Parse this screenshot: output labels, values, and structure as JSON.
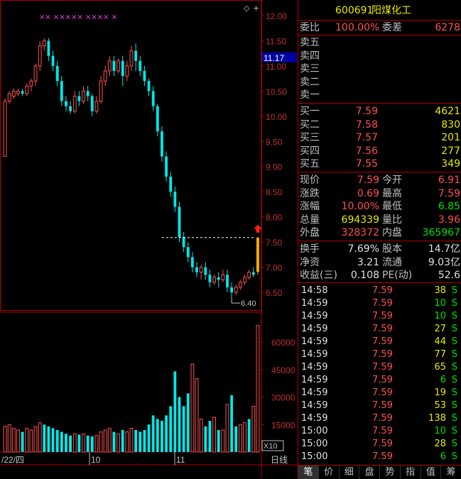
{
  "stock": {
    "code": "600691",
    "name": "阳煤化工"
  },
  "colors": {
    "up": "#ff5050",
    "down": "#00e8e8",
    "grid": "#b00000",
    "limit_bar": "#ffb000"
  },
  "order_ratio": {
    "label1": "委比",
    "value1": "100.00%",
    "label2": "委差",
    "value2": "6278"
  },
  "asks": [
    {
      "label": "卖五",
      "price": "",
      "vol": ""
    },
    {
      "label": "卖四",
      "price": "",
      "vol": ""
    },
    {
      "label": "卖三",
      "price": "",
      "vol": ""
    },
    {
      "label": "卖二",
      "price": "",
      "vol": ""
    },
    {
      "label": "卖一",
      "price": "",
      "vol": ""
    }
  ],
  "bids": [
    {
      "label": "买一",
      "price": "7.59",
      "vol": "4621"
    },
    {
      "label": "买二",
      "price": "7.58",
      "vol": "830"
    },
    {
      "label": "买三",
      "price": "7.57",
      "vol": "201"
    },
    {
      "label": "买四",
      "price": "7.56",
      "vol": "277"
    },
    {
      "label": "买五",
      "price": "7.55",
      "vol": "349"
    }
  ],
  "quote": [
    {
      "l1": "现价",
      "v1": "7.59",
      "c1": "red",
      "l2": "今开",
      "v2": "6.91",
      "c2": "red"
    },
    {
      "l1": "涨跌",
      "v1": "0.69",
      "c1": "red",
      "l2": "最高",
      "v2": "7.59",
      "c2": "red"
    },
    {
      "l1": "涨幅",
      "v1": "10.00%",
      "c1": "red",
      "l2": "最低",
      "v2": "6.85",
      "c2": "green"
    },
    {
      "l1": "总量",
      "v1": "694339",
      "c1": "yellow",
      "l2": "量比",
      "v2": "3.96",
      "c2": "red"
    },
    {
      "l1": "外盘",
      "v1": "328372",
      "c1": "red",
      "l2": "内盘",
      "v2": "365967",
      "c2": "green"
    }
  ],
  "stats": [
    {
      "l1": "换手",
      "v1": "7.69%",
      "l2": "股本",
      "v2": "14.7亿"
    },
    {
      "l1": "净资",
      "v1": "3.21",
      "l2": "流通",
      "v2": "9.03亿"
    },
    {
      "l1": "收益(三)",
      "v1": "0.108",
      "l2": "PE(动)",
      "v2": "52.6"
    }
  ],
  "ticks": [
    {
      "time": "14:58",
      "price": "7.59",
      "vol": "38",
      "side": "S",
      "vc": "yellow"
    },
    {
      "time": "14:59",
      "price": "7.59",
      "vol": "10",
      "side": "S",
      "vc": "green"
    },
    {
      "time": "14:59",
      "price": "7.59",
      "vol": "10",
      "side": "S",
      "vc": "green"
    },
    {
      "time": "14:59",
      "price": "7.59",
      "vol": "27",
      "side": "S",
      "vc": "yellow"
    },
    {
      "time": "14:59",
      "price": "7.59",
      "vol": "44",
      "side": "S",
      "vc": "yellow"
    },
    {
      "time": "14:59",
      "price": "7.59",
      "vol": "77",
      "side": "S",
      "vc": "yellow"
    },
    {
      "time": "14:59",
      "price": "7.59",
      "vol": "65",
      "side": "S",
      "vc": "yellow"
    },
    {
      "time": "14:59",
      "price": "7.59",
      "vol": "6",
      "side": "S",
      "vc": "green"
    },
    {
      "time": "14:59",
      "price": "7.59",
      "vol": "19",
      "side": "S",
      "vc": "yellow"
    },
    {
      "time": "14:59",
      "price": "7.59",
      "vol": "53",
      "side": "S",
      "vc": "yellow"
    },
    {
      "time": "14:59",
      "price": "7.59",
      "vol": "138",
      "side": "S",
      "vc": "yellow"
    },
    {
      "time": "15:00",
      "price": "7.59",
      "vol": "10",
      "side": "S",
      "vc": "green"
    },
    {
      "time": "15:00",
      "price": "7.59",
      "vol": "28",
      "side": "S",
      "vc": "yellow"
    },
    {
      "time": "15:00",
      "price": "7.59",
      "vol": "6",
      "side": "S",
      "vc": "green"
    }
  ],
  "tabs": [
    "笔",
    "价",
    "细",
    "盘",
    "势",
    "指",
    "值",
    "筹"
  ],
  "chart": {
    "price_axis": [
      "12.00",
      "11.50",
      "11.00",
      "10.50",
      "10.00",
      "9.50",
      "9.00",
      "8.50",
      "8.00",
      "7.50",
      "7.00",
      "6.50"
    ],
    "current_price_tag": "11.17",
    "low_label": "6.40",
    "volume_axis": [
      "60000",
      "45000",
      "30000",
      "15000"
    ],
    "volume_unit": "X10",
    "date_labels": [
      "/22/四",
      "10",
      "11"
    ],
    "period_label": "日线",
    "markers": "××  ×××××  ××××  ×",
    "candles": [
      [
        9.2,
        10.3,
        9.2,
        10.35,
        1
      ],
      [
        10.3,
        10.45,
        10.25,
        10.5,
        1
      ],
      [
        10.4,
        10.5,
        10.35,
        10.55,
        1
      ],
      [
        10.45,
        10.5,
        10.4,
        10.55,
        1
      ],
      [
        10.5,
        10.45,
        10.4,
        10.55,
        0
      ],
      [
        10.45,
        10.6,
        10.4,
        10.65,
        1
      ],
      [
        10.6,
        10.7,
        10.5,
        10.75,
        1
      ],
      [
        10.7,
        11.0,
        10.6,
        11.05,
        1
      ],
      [
        11.0,
        11.4,
        10.9,
        11.5,
        1
      ],
      [
        11.4,
        11.5,
        11.3,
        11.55,
        1
      ],
      [
        11.5,
        11.2,
        11.1,
        11.55,
        0
      ],
      [
        11.2,
        11.0,
        10.9,
        11.3,
        0
      ],
      [
        11.0,
        10.7,
        10.6,
        11.1,
        0
      ],
      [
        10.7,
        10.3,
        10.2,
        10.8,
        0
      ],
      [
        10.3,
        10.2,
        10.1,
        10.4,
        0
      ],
      [
        10.2,
        10.1,
        10.05,
        10.3,
        0
      ],
      [
        10.1,
        10.4,
        10.05,
        10.5,
        1
      ],
      [
        10.4,
        10.3,
        10.2,
        10.5,
        0
      ],
      [
        10.3,
        10.5,
        10.25,
        10.6,
        1
      ],
      [
        10.5,
        10.4,
        10.3,
        10.6,
        0
      ],
      [
        10.4,
        10.1,
        10.0,
        10.45,
        0
      ],
      [
        10.1,
        10.3,
        10.05,
        10.4,
        1
      ],
      [
        10.3,
        10.7,
        10.25,
        10.8,
        1
      ],
      [
        10.7,
        10.9,
        10.6,
        11.0,
        1
      ],
      [
        10.9,
        11.1,
        10.8,
        11.2,
        1
      ],
      [
        11.1,
        10.9,
        10.8,
        11.2,
        0
      ],
      [
        10.9,
        11.1,
        10.85,
        11.15,
        1
      ],
      [
        11.1,
        10.8,
        10.6,
        11.2,
        0
      ],
      [
        10.8,
        11.0,
        10.7,
        11.1,
        1
      ],
      [
        11.0,
        11.3,
        10.9,
        11.4,
        1
      ],
      [
        11.3,
        11.1,
        10.9,
        11.45,
        0
      ],
      [
        11.1,
        10.9,
        10.8,
        11.2,
        0
      ],
      [
        10.9,
        10.7,
        10.6,
        11.0,
        0
      ],
      [
        10.7,
        10.5,
        10.4,
        10.75,
        0
      ],
      [
        10.5,
        10.2,
        10.1,
        10.6,
        0
      ],
      [
        10.2,
        9.7,
        9.6,
        10.25,
        0
      ],
      [
        9.7,
        9.2,
        9.1,
        9.8,
        0
      ],
      [
        9.2,
        8.8,
        8.7,
        9.3,
        0
      ],
      [
        8.8,
        8.5,
        8.4,
        8.9,
        0
      ],
      [
        8.5,
        8.2,
        8.1,
        8.6,
        0
      ],
      [
        8.2,
        7.6,
        7.5,
        8.3,
        0
      ],
      [
        7.6,
        7.4,
        7.3,
        7.7,
        0
      ],
      [
        7.4,
        7.2,
        7.1,
        7.5,
        0
      ],
      [
        7.2,
        7.0,
        6.9,
        7.3,
        0
      ],
      [
        7.0,
        6.9,
        6.8,
        7.1,
        0
      ],
      [
        6.9,
        7.0,
        6.75,
        7.05,
        1
      ],
      [
        7.0,
        6.85,
        6.75,
        7.1,
        0
      ],
      [
        6.85,
        6.7,
        6.6,
        6.95,
        0
      ],
      [
        6.7,
        6.8,
        6.65,
        6.85,
        1
      ],
      [
        6.8,
        6.75,
        6.6,
        6.9,
        0
      ],
      [
        6.75,
        6.85,
        6.7,
        6.95,
        1
      ],
      [
        6.85,
        6.6,
        6.5,
        6.95,
        0
      ],
      [
        6.6,
        6.5,
        6.4,
        6.7,
        0
      ],
      [
        6.5,
        6.6,
        6.45,
        6.65,
        1
      ],
      [
        6.6,
        6.7,
        6.55,
        6.75,
        1
      ],
      [
        6.7,
        6.8,
        6.65,
        6.85,
        1
      ],
      [
        6.8,
        6.9,
        6.75,
        6.95,
        1
      ],
      [
        6.9,
        6.85,
        6.8,
        7.0,
        0
      ],
      [
        6.91,
        7.59,
        6.85,
        7.59,
        2
      ]
    ],
    "volumes": [
      [
        14000,
        1
      ],
      [
        15000,
        1
      ],
      [
        13000,
        1
      ],
      [
        12000,
        1
      ],
      [
        11000,
        0
      ],
      [
        13000,
        1
      ],
      [
        12000,
        1
      ],
      [
        14000,
        1
      ],
      [
        16000,
        1
      ],
      [
        15000,
        0
      ],
      [
        14000,
        0
      ],
      [
        13000,
        0
      ],
      [
        12000,
        0
      ],
      [
        11000,
        0
      ],
      [
        10000,
        0
      ],
      [
        9000,
        0
      ],
      [
        10000,
        1
      ],
      [
        9500,
        0
      ],
      [
        10000,
        1
      ],
      [
        9000,
        0
      ],
      [
        8500,
        0
      ],
      [
        9000,
        1
      ],
      [
        11000,
        1
      ],
      [
        12000,
        1
      ],
      [
        13000,
        1
      ],
      [
        11000,
        0
      ],
      [
        10000,
        1
      ],
      [
        12000,
        0
      ],
      [
        11000,
        1
      ],
      [
        13000,
        1
      ],
      [
        12000,
        0
      ],
      [
        11000,
        0
      ],
      [
        12000,
        0
      ],
      [
        15000,
        0
      ],
      [
        20000,
        0
      ],
      [
        18000,
        0
      ],
      [
        17000,
        0
      ],
      [
        20000,
        0
      ],
      [
        25000,
        0
      ],
      [
        44000,
        0
      ],
      [
        30000,
        0
      ],
      [
        25000,
        0
      ],
      [
        32000,
        0
      ],
      [
        48000,
        1
      ],
      [
        40000,
        1
      ],
      [
        18000,
        1
      ],
      [
        14000,
        0
      ],
      [
        17000,
        0
      ],
      [
        19000,
        1
      ],
      [
        12000,
        0
      ],
      [
        12000,
        1
      ],
      [
        26000,
        1
      ],
      [
        31000,
        0
      ],
      [
        14000,
        0
      ],
      [
        15000,
        1
      ],
      [
        16000,
        1
      ],
      [
        18000,
        0
      ],
      [
        25000,
        1
      ],
      [
        69000,
        2
      ]
    ]
  }
}
